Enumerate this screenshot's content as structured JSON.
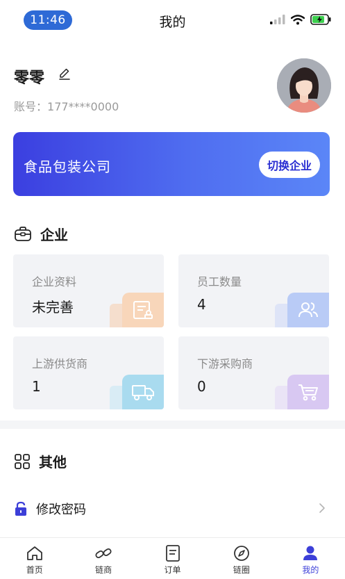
{
  "status_bar": {
    "time": "11:46",
    "title": "我的"
  },
  "profile": {
    "name": "零零",
    "account_label": "账号：",
    "account_value": "177****0000"
  },
  "company": {
    "name": "食品包装公司",
    "switch_label": "切换企业"
  },
  "enterprise_section": {
    "title": "企业",
    "tiles": [
      {
        "label": "企业资料",
        "value": "未完善",
        "icon": "document-stamp-icon",
        "accent": "#f7c9a4"
      },
      {
        "label": "员工数量",
        "value": "4",
        "icon": "people-icon",
        "accent": "#b9cbf6"
      },
      {
        "label": "上游供货商",
        "value": "1",
        "icon": "truck-icon",
        "accent": "#a9dbef"
      },
      {
        "label": "下游采购商",
        "value": "0",
        "icon": "cart-icon",
        "accent": "#d8c8f2"
      }
    ]
  },
  "other_section": {
    "title": "其他",
    "items": [
      {
        "label": "修改密码",
        "icon": "lock-icon"
      }
    ]
  },
  "tab_bar": {
    "active": "我的",
    "tabs": [
      {
        "label": "首页",
        "icon": "home-icon"
      },
      {
        "label": "链商",
        "icon": "link-icon"
      },
      {
        "label": "订单",
        "icon": "order-icon"
      },
      {
        "label": "链圈",
        "icon": "compass-icon"
      },
      {
        "label": "我的",
        "icon": "user-icon"
      }
    ]
  },
  "colors": {
    "accent": "#3c3fd8",
    "card_gradient_start": "#3b3fe0",
    "card_gradient_end": "#5b86f7"
  }
}
